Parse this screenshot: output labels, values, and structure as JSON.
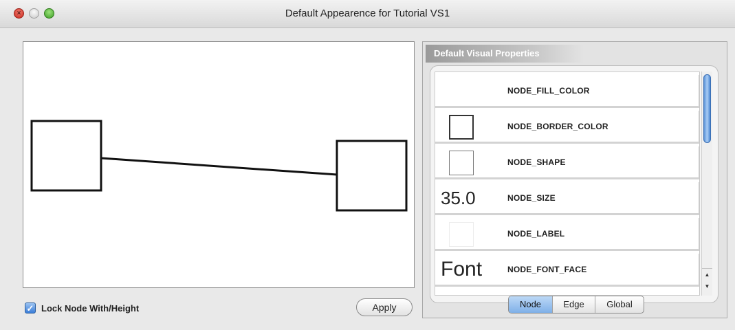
{
  "window": {
    "title": "Default Appearence for Tutorial VS1",
    "buttons": [
      {
        "name": "close",
        "glyph": "×"
      },
      {
        "name": "minimize",
        "glyph": "–"
      },
      {
        "name": "zoom",
        "glyph": "+"
      }
    ]
  },
  "preview": {
    "lock_checked": true,
    "check_glyph": "✓",
    "lock_label": "Lock Node With/Height",
    "apply_label": "Apply"
  },
  "panel": {
    "header": "Default Visual Properties",
    "properties": [
      {
        "swatch_type": "none",
        "swatch_text": "",
        "label": "NODE_FILL_COLOR"
      },
      {
        "swatch_type": "box",
        "swatch_text": "",
        "label": "NODE_BORDER_COLOR"
      },
      {
        "swatch_type": "box-light",
        "swatch_text": "",
        "label": "NODE_SHAPE"
      },
      {
        "swatch_type": "text",
        "swatch_text": "35.0",
        "label": "NODE_SIZE"
      },
      {
        "swatch_type": "box-faint",
        "swatch_text": "",
        "label": "NODE_LABEL"
      },
      {
        "swatch_type": "text-big",
        "swatch_text": "Font",
        "label": "NODE_FONT_FACE"
      }
    ],
    "scroll_up_glyph": "▲",
    "scroll_down_glyph": "▼",
    "tabs": [
      {
        "label": "Node",
        "active": true
      },
      {
        "label": "Edge",
        "active": false
      },
      {
        "label": "Global",
        "active": false
      }
    ]
  }
}
